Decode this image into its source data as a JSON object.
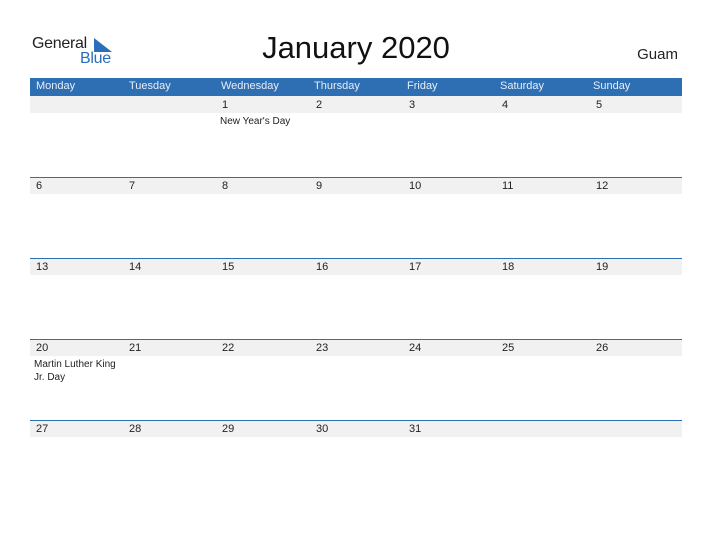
{
  "logo": {
    "word1": "General",
    "word2": "Blue"
  },
  "title": "January 2020",
  "region": "Guam",
  "colors": {
    "accent": "#2e6fb3",
    "strip": "#f1f1f1"
  },
  "days": [
    "Monday",
    "Tuesday",
    "Wednesday",
    "Thursday",
    "Friday",
    "Saturday",
    "Sunday"
  ],
  "weeks": [
    [
      {
        "d": ""
      },
      {
        "d": ""
      },
      {
        "d": "1",
        "h": "New Year's Day"
      },
      {
        "d": "2"
      },
      {
        "d": "3"
      },
      {
        "d": "4"
      },
      {
        "d": "5"
      }
    ],
    [
      {
        "d": "6"
      },
      {
        "d": "7"
      },
      {
        "d": "8"
      },
      {
        "d": "9"
      },
      {
        "d": "10"
      },
      {
        "d": "11"
      },
      {
        "d": "12"
      }
    ],
    [
      {
        "d": "13"
      },
      {
        "d": "14"
      },
      {
        "d": "15"
      },
      {
        "d": "16"
      },
      {
        "d": "17"
      },
      {
        "d": "18"
      },
      {
        "d": "19"
      }
    ],
    [
      {
        "d": "20",
        "h": "Martin Luther King Jr. Day"
      },
      {
        "d": "21"
      },
      {
        "d": "22"
      },
      {
        "d": "23"
      },
      {
        "d": "24"
      },
      {
        "d": "25"
      },
      {
        "d": "26"
      }
    ],
    [
      {
        "d": "27"
      },
      {
        "d": "28"
      },
      {
        "d": "29"
      },
      {
        "d": "30"
      },
      {
        "d": "31"
      },
      {
        "d": ""
      },
      {
        "d": ""
      }
    ]
  ]
}
